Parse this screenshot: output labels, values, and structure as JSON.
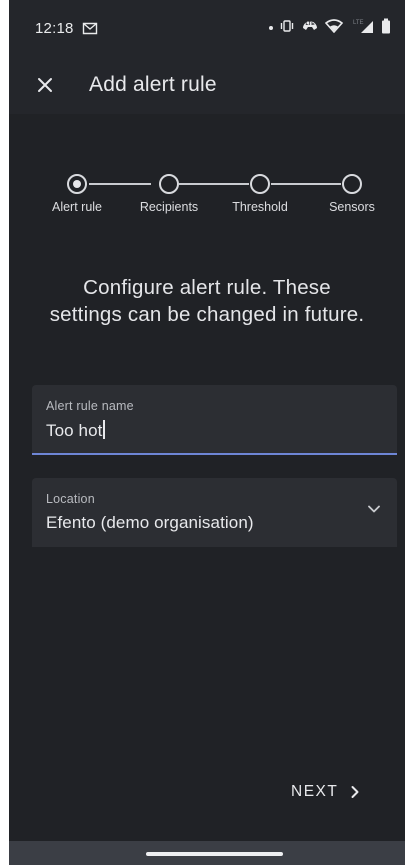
{
  "status_bar": {
    "time": "12:18",
    "icons": [
      "mail-icon",
      "vibrate-icon",
      "volte-call-icon",
      "wifi-icon",
      "lte-signal-icon",
      "battery-icon"
    ],
    "lte_label": "LTE"
  },
  "app_bar": {
    "close_icon": "close-icon",
    "title": "Add alert rule"
  },
  "stepper": {
    "steps": [
      {
        "label": "Alert rule",
        "active": true
      },
      {
        "label": "Recipients",
        "active": false
      },
      {
        "label": "Threshold",
        "active": false
      },
      {
        "label": "Sensors",
        "active": false
      }
    ]
  },
  "instruction": {
    "line1": "Configure alert rule. These",
    "line2": "settings can be changed in future."
  },
  "form": {
    "name_field": {
      "label": "Alert rule name",
      "value": "Too hot"
    },
    "location_field": {
      "label": "Location",
      "value": "Efento (demo organisation)",
      "icon": "chevron-down-icon"
    }
  },
  "footer": {
    "next_label": "NEXT",
    "next_icon": "chevron-right-icon"
  },
  "colors": {
    "background": "#24262b",
    "content_bg": "#202226",
    "field_bg": "#2c2e33",
    "accent": "#6e86d6",
    "nav_bar": "#3b3e45"
  }
}
